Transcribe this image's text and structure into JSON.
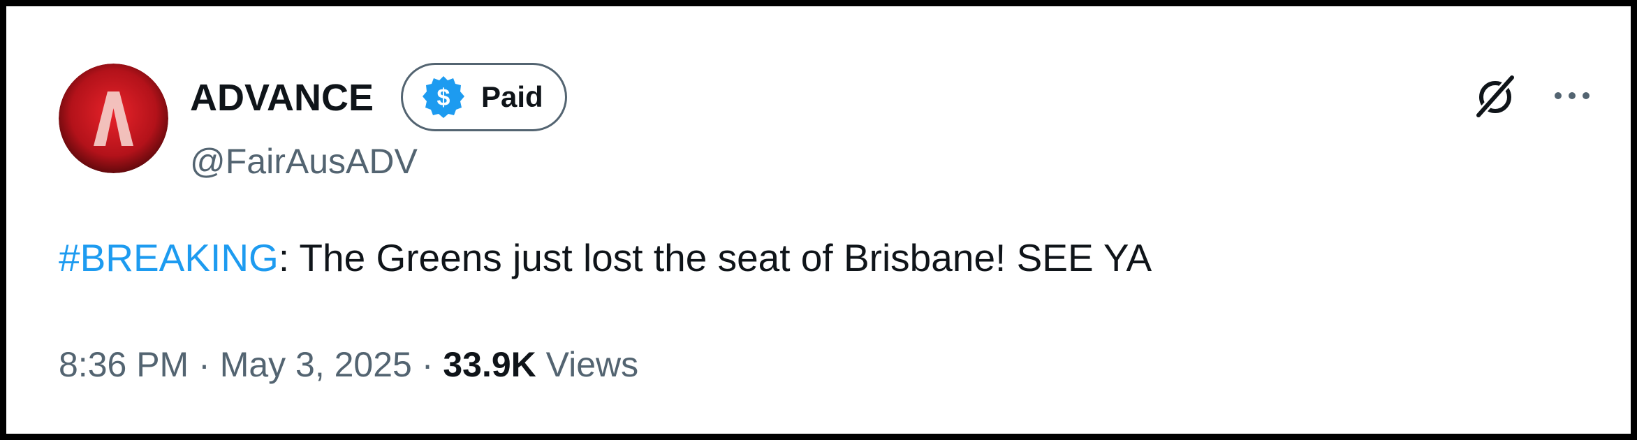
{
  "tweet": {
    "author": {
      "display_name": "ADVANCE",
      "handle": "@FairAusADV",
      "badge": {
        "label": "Paid",
        "icon": "dollar-coin-icon",
        "color": "#1d9bf0"
      },
      "avatar": {
        "icon": "advance-logo-icon",
        "colors": {
          "background": "#c0151c",
          "mark": "#f3c9c4"
        }
      }
    },
    "text": {
      "hashtag": "#BREAKING",
      "body": ": The Greens just lost the seat of Brisbane! SEE YA"
    },
    "meta": {
      "time": "8:36 PM",
      "separator": "·",
      "date": "May 3, 2025",
      "views_count": "33.9K",
      "views_label": "Views"
    },
    "actions": {
      "grok_icon": "grok-icon",
      "more_icon": "more-icon"
    }
  },
  "colors": {
    "text_primary": "#0f1419",
    "text_secondary": "#536471",
    "accent": "#1d9bf0"
  }
}
